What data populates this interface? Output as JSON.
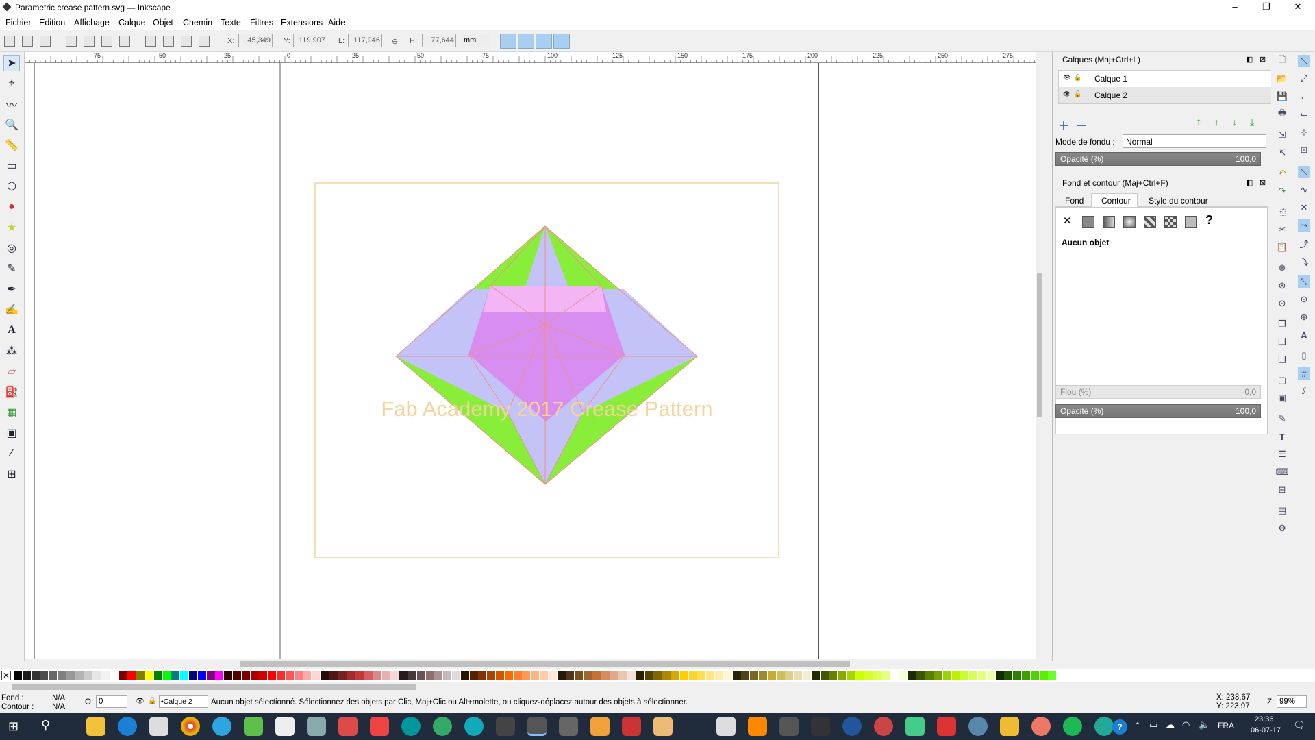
{
  "window": {
    "title": "Parametric crease pattern.svg — Inkscape",
    "controls": [
      "–",
      "❐",
      "✕"
    ]
  },
  "menu": [
    "Fichier",
    "Édition",
    "Affichage",
    "Calque",
    "Objet",
    "Chemin",
    "Texte",
    "Filtres",
    "Extensions",
    "Aide"
  ],
  "toolbar": {
    "x_label": "X:",
    "x_value": "45,349",
    "y_label": "Y:",
    "y_value": "119,907",
    "w_label": "L:",
    "w_value": "117,946",
    "h_label": "H:",
    "h_value": "77,644",
    "unit": "mm"
  },
  "ruler": {
    "top_labels": [
      "-75",
      "-50",
      "-25",
      "0",
      "25",
      "50",
      "75",
      "100",
      "125",
      "150",
      "175",
      "200",
      "225",
      "250",
      "275"
    ]
  },
  "canvas": {
    "caption": "Fab Academy 2017 Crease Pattern",
    "colors": {
      "green": "#88ee3a",
      "lavender": "#c3c3f7",
      "pink": "#f3b5f3",
      "violet": "#d78ef0",
      "crease": "#ee8f87",
      "frame": "#f6d39a"
    }
  },
  "layers_panel": {
    "title": "Calques (Maj+Ctrl+L)",
    "layers": [
      "Calque 1",
      "Calque 2"
    ],
    "blend_label": "Mode de fondu :",
    "blend_value": "Normal",
    "opacity_label": "Opacité (%)",
    "opacity_value": "100,0"
  },
  "fill_panel": {
    "title": "Fond et contour (Maj+Ctrl+F)",
    "tabs": [
      "Fond",
      "Contour",
      "Style du contour"
    ],
    "no_object": "Aucun objet",
    "blur_label": "Flou (%)",
    "blur_value": "0,0",
    "opacity_label": "Opacité (%)",
    "opacity_value": "100,0"
  },
  "status": {
    "fill_label": "Fond :",
    "fill_value": "N/A",
    "stroke_label": "Contour :",
    "stroke_value": "N/A",
    "o_label": "O:",
    "o_value": "0",
    "layer": "•Calque 2",
    "message": "Aucun objet sélectionné. Sélectionnez des objets par Clic, Maj+Clic ou Alt+molette, ou cliquez-déplacez autour des objets à sélectionner.",
    "cursor_x": "X: 238,67",
    "cursor_y": "Y: 223,97",
    "zoom_label": "Z:",
    "zoom": "99%"
  },
  "taskbar": {
    "lang": "FRA",
    "time": "23:36",
    "date": "06-07-17"
  }
}
